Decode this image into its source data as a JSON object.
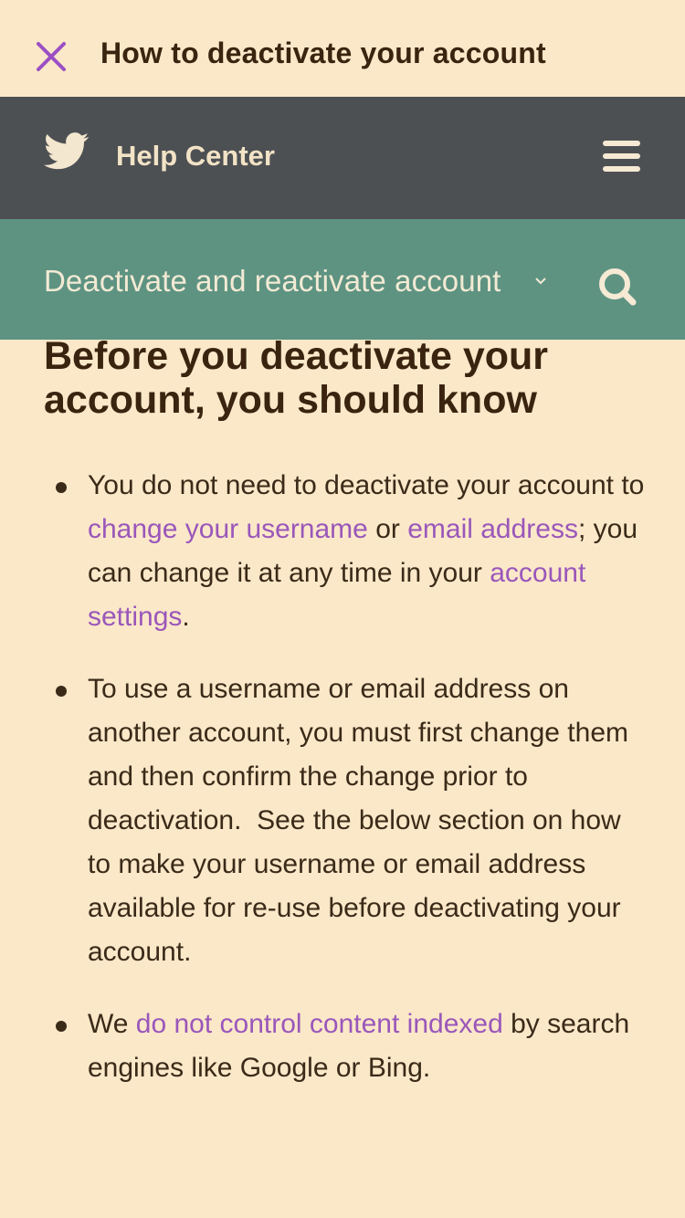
{
  "header": {
    "close_icon": "close-x-icon",
    "title": "How to deactivate your account"
  },
  "navbar": {
    "logo_icon": "twitter-bird-icon",
    "site_name": "Help Center",
    "menu_icon": "hamburger-menu-icon"
  },
  "subnav": {
    "topic_selected": "Deactivate and reactivate account",
    "dropdown_icon": "chevron-down-icon",
    "search_icon": "search-icon"
  },
  "content": {
    "title": "Before you deactivate your account, you should know",
    "bullet1": {
      "t1": "You do not need to deactivate your account to ",
      "link1": "change your username",
      "t2": " or ",
      "link2": "email address",
      "t3": "; you can change it at any time in your ",
      "link3": "account settings",
      "t4": "."
    },
    "bullet2": {
      "text": "To use a username or email address on another account, you must first change them and then confirm the change prior to deactivation.  See the below section on how to make your username or email address available for re-use before deactivating your account."
    },
    "bullet3": {
      "t1": "We ",
      "link1": "do not control content indexed",
      "t2": " by search engines like Google or Bing."
    }
  },
  "colors": {
    "background": "#fbe8c9",
    "navbar": "#4d5053",
    "subnav": "#5e9382",
    "link": "#9a57ba",
    "close_icon": "#9b4fc4"
  }
}
